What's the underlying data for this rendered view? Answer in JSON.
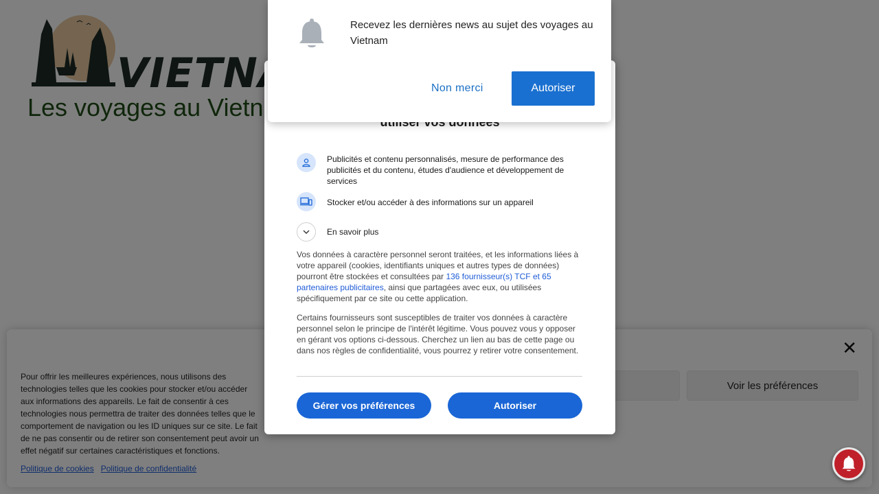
{
  "site": {
    "logo_text": "VIETNAM",
    "title": "Les voyages au Vietnam"
  },
  "cookie_banner": {
    "text": "Pour offrir les meilleures expériences, nous utilisons des technologies telles que les cookies pour stocker et/ou accéder aux informations des appareils. Le fait de consentir à ces technologies nous permettra de traiter des données telles que le comportement de navigation ou les ID uniques sur ce site. Le fait de ne pas consentir ou de retirer son consentement peut avoir un effet négatif sur certaines caractéristiques et fonctions.",
    "preferences_label": "Voir les préférences",
    "cookie_policy_link": "Politique de cookies",
    "privacy_policy_link": "Politique de confidentialité",
    "close_icon": "close-icon"
  },
  "consent_dialog": {
    "heading": "utiliser vos données",
    "purposes": [
      {
        "icon": "person-icon",
        "label": "Publicités et contenu personnalisés, mesure de performance des publicités et du contenu, études d'audience et développement de services"
      },
      {
        "icon": "devices-icon",
        "label": "Stocker et/ou accéder à des informations sur un appareil"
      }
    ],
    "learn_more_label": "En savoir plus",
    "body_1_before": "Vos données à caractère personnel seront traitées, et les informations liées à votre appareil (cookies, identifiants uniques et autres types de données) pourront être stockées et consultées par ",
    "body_1_link": "136 fournisseur(s) TCF et 65 partenaires publicitaires",
    "body_1_after": ", ainsi que partagées avec eux, ou utilisées spécifiquement par ce site ou cette application.",
    "body_2": "Certains fournisseurs sont susceptibles de traiter vos données à caractère personnel selon le principe de l'intérêt légitime. Vous pouvez vous y opposer en gérant vos options ci-dessous. Cherchez un lien au bas de cette page ou dans nos règles de confidentialité, vous pourrez y retirer votre consentement.",
    "manage_label": "Gérer vos préférences",
    "accept_label": "Autoriser"
  },
  "push_prompt": {
    "icon": "bell-icon",
    "message": "Recevez les dernières news au sujet des voyages au Vietnam",
    "decline_label": "Non merci",
    "allow_label": "Autoriser"
  },
  "bell_button": {
    "icon": "bell-icon"
  },
  "colors": {
    "primary_blue": "#1a66d6",
    "push_blue": "#1a70d0",
    "bell_red": "#c0202a"
  }
}
